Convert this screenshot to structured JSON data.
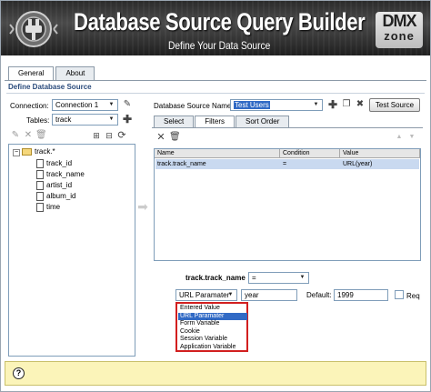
{
  "header": {
    "title": "Database Source Query Builder",
    "subtitle": "Define Your Data Source",
    "brand_line1": "DMX",
    "brand_line2": "zone"
  },
  "tabs": [
    {
      "label": "General",
      "active": true
    },
    {
      "label": "About",
      "active": false
    }
  ],
  "section_title": "Define Database Source",
  "connection": {
    "label": "Connection:",
    "value": "Connection 1"
  },
  "tables": {
    "label": "Tables:",
    "value": "track"
  },
  "source": {
    "label": "Database Source Name:",
    "value": "Test Users",
    "test_button": "Test Source"
  },
  "subtabs": [
    {
      "label": "Select",
      "active": false
    },
    {
      "label": "Filters",
      "active": true
    },
    {
      "label": "Sort Order",
      "active": false
    }
  ],
  "tree": {
    "root": "track.*",
    "fields": [
      "track_id",
      "track_name",
      "artist_id",
      "album_id",
      "time"
    ]
  },
  "grid": {
    "columns": [
      "Name",
      "Condition",
      "Value"
    ],
    "rows": [
      {
        "name": "track.track_name",
        "condition": "=",
        "value": "URL(year)"
      }
    ]
  },
  "filter_editor": {
    "field_name": "track.track_name",
    "condition_value": "=",
    "param_type": "URL Paramater",
    "param_name": "year",
    "default_label": "Default:",
    "default_value": "1999",
    "required_label": "Req"
  },
  "param_options": [
    "Entered Value",
    "URL Paramater",
    "Form Variable",
    "Cookie",
    "Session Variable",
    "Application Variable"
  ],
  "param_selected_index": 1,
  "colors": {
    "accent": "#316ac5",
    "highlight_border": "#d21f1f",
    "footer_bg": "#fbf4b9",
    "section_title": "#2a4b7c"
  },
  "footer": {
    "help_glyph": "?"
  }
}
